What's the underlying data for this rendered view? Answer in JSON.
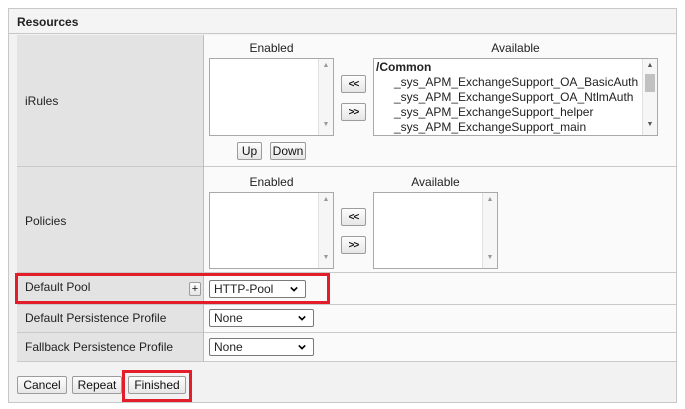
{
  "section": {
    "title": "Resources"
  },
  "irules": {
    "label": "iRules",
    "enabled_header": "Enabled",
    "available_header": "Available",
    "enabled_items": [],
    "available_items": [
      "/Common",
      "_sys_APM_ExchangeSupport_OA_BasicAuth",
      "_sys_APM_ExchangeSupport_OA_NtlmAuth",
      "_sys_APM_ExchangeSupport_helper",
      "_sys_APM_ExchangeSupport_main"
    ],
    "move_left": "<<",
    "move_right": ">>",
    "up": "Up",
    "down": "Down"
  },
  "policies": {
    "label": "Policies",
    "enabled_header": "Enabled",
    "available_header": "Available",
    "move_left": "<<",
    "move_right": ">>"
  },
  "default_pool": {
    "label": "Default Pool",
    "add_icon": "+",
    "value": "HTTP-Pool"
  },
  "default_persistence": {
    "label": "Default Persistence Profile",
    "value": "None"
  },
  "fallback_persistence": {
    "label": "Fallback Persistence Profile",
    "value": "None"
  },
  "footer": {
    "cancel": "Cancel",
    "repeat": "Repeat",
    "finished": "Finished"
  },
  "colors": {
    "highlight": "#e41d2a",
    "label_bg": "#e3e3e3",
    "value_bg": "#fafafa"
  },
  "icons": [
    "scroll-up-icon",
    "scroll-down-icon",
    "chevron-down-icon",
    "plus-icon"
  ]
}
